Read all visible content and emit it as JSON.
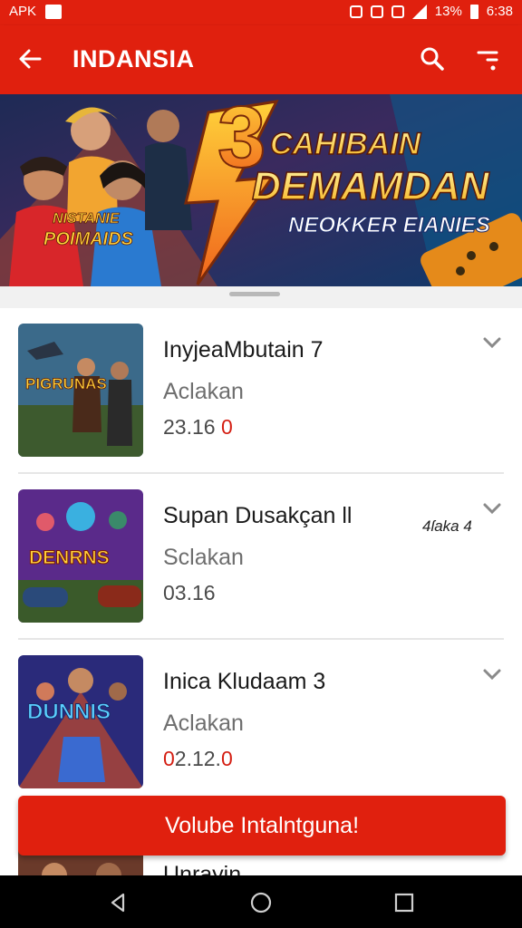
{
  "status_bar": {
    "left_text": "APK",
    "battery": "13%",
    "time": "6:38"
  },
  "app_bar": {
    "title": "INDANSIA"
  },
  "banner": {
    "number": "3",
    "line1": "CAHIBAIN",
    "line2": "DEMAMDAN",
    "line3": "NEOKKER EIANIES",
    "left_title_1": "NISTANIE",
    "left_title_2": "POIMAIDS"
  },
  "games": [
    {
      "title": "InyjeaMbutain 7",
      "category": "Aclakan",
      "price_main": "23.16",
      "price_accent": "0",
      "note": "",
      "thumb_text": "PIGRUNAS"
    },
    {
      "title": "Supan Dusakçan ll",
      "category": "Sclakan",
      "price_main": "03.16",
      "price_accent": "",
      "note": "4ſaka 4",
      "thumb_text": "DENRNS"
    },
    {
      "title": "Inica Kludaam 3",
      "category": "Aclakan",
      "price_main": "2.12.",
      "price_prefix": "0",
      "price_accent": "0",
      "note": "",
      "thumb_text": "DUNNIS"
    },
    {
      "title": "Unrayin",
      "category": "",
      "price_main": "",
      "price_accent": "",
      "note": "",
      "thumb_text": ""
    }
  ],
  "cta": {
    "label": "Volube Intalntguna!"
  },
  "colors": {
    "primary": "#e0200e",
    "accent_text": "#d41e12",
    "nav_bar": "#000000"
  },
  "icons": {
    "back": "arrow-left-icon",
    "search": "search-icon",
    "filter": "filter-icon",
    "chevron": "chevron-down-icon",
    "nav_back": "triangle-back-icon",
    "nav_home": "circle-home-icon",
    "nav_recent": "square-recent-icon"
  }
}
